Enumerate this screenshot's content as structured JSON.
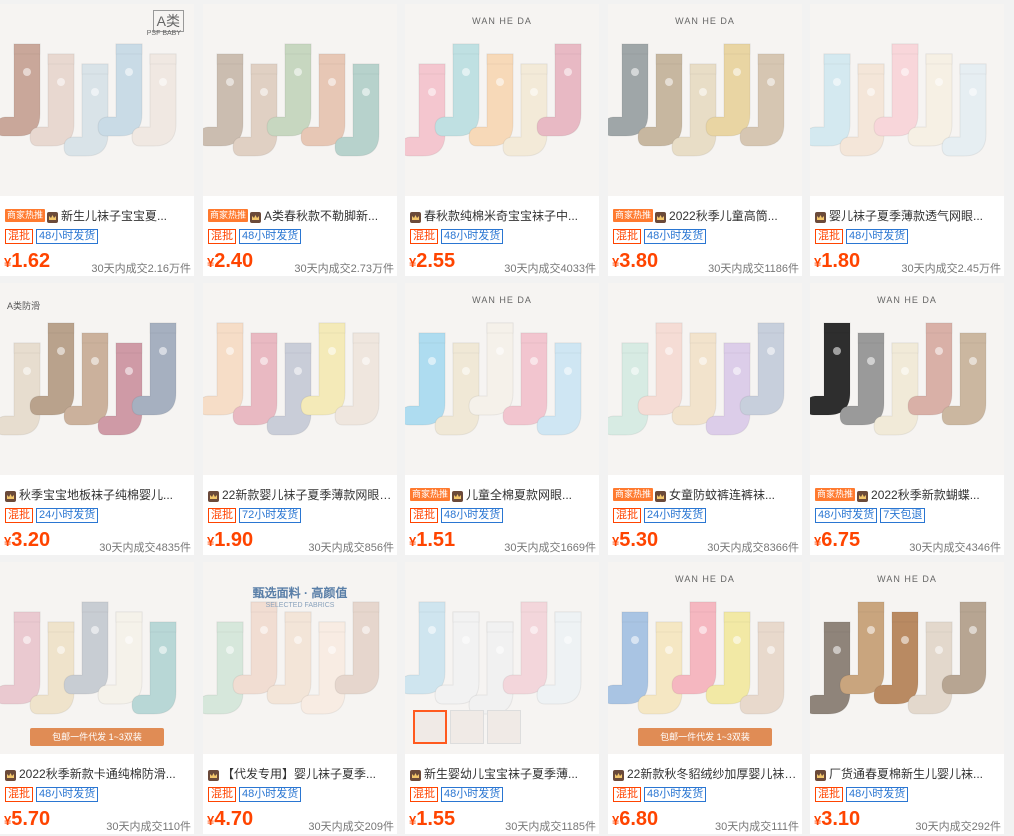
{
  "colors": {
    "price": "#ff4400",
    "tag_red": "#ff4400",
    "tag_blue": "#2a76d2",
    "hot_badge": "#ff7a2f",
    "page_bg": "#f2f2f2"
  },
  "products": [
    {
      "hot": "商家热推",
      "title": "新生儿袜子宝宝夏...",
      "tags": [
        "混批",
        "48小时发货"
      ],
      "price": "1.62",
      "sales": "30天内成交2.16万件",
      "overlay_text": "A类",
      "overlay_sub": "PSF BABY"
    },
    {
      "hot": "商家热推",
      "title": "A类春秋款不勒脚新...",
      "tags": [
        "混批",
        "48小时发货"
      ],
      "price": "2.40",
      "sales": "30天内成交2.73万件"
    },
    {
      "hot": "",
      "title": "春秋款纯棉米奇宝宝袜子中...",
      "tags": [
        "混批",
        "48小时发货"
      ],
      "price": "2.55",
      "sales": "30天内成交4033件",
      "overlay_text": "WAN HE DA"
    },
    {
      "hot": "商家热推",
      "title": "2022秋季儿童高筒...",
      "tags": [
        "混批",
        "48小时发货"
      ],
      "price": "3.80",
      "sales": "30天内成交1186件",
      "overlay_text": "WAN HE DA"
    },
    {
      "hot": "",
      "title": "婴儿袜子夏季薄款透气网眼...",
      "tags": [
        "混批",
        "48小时发货"
      ],
      "price": "1.80",
      "sales": "30天内成交2.45万件"
    },
    {
      "hot": "",
      "title": "秋季宝宝地板袜子纯棉婴儿...",
      "tags": [
        "混批",
        "24小时发货"
      ],
      "price": "3.20",
      "sales": "30天内成交4835件",
      "overlay_text": "A类防滑"
    },
    {
      "hot": "",
      "title": "22新款婴儿袜子夏季薄款网眼新...",
      "tags": [
        "混批",
        "72小时发货"
      ],
      "price": "1.90",
      "sales": "30天内成交856件"
    },
    {
      "hot": "商家热推",
      "title": "儿童全棉夏款网眼...",
      "tags": [
        "混批",
        "48小时发货"
      ],
      "price": "1.51",
      "sales": "30天内成交1669件",
      "overlay_text": "WAN HE DA"
    },
    {
      "hot": "商家热推",
      "title": "女童防蚊裤连裤袜...",
      "tags": [
        "混批",
        "24小时发货"
      ],
      "price": "5.30",
      "sales": "30天内成交8366件"
    },
    {
      "hot": "商家热推",
      "title": "2022秋季新款蝴蝶...",
      "tags": [
        "48小时发货",
        "7天包退"
      ],
      "price": "6.75",
      "sales": "30天内成交4346件",
      "overlay_text": "WAN HE DA"
    },
    {
      "hot": "",
      "title": "2022秋季新款卡通纯棉防滑...",
      "tags": [
        "混批",
        "48小时发货"
      ],
      "price": "5.70",
      "sales": "30天内成交110件",
      "overlay_text": "包邮一件代发 1~3双装"
    },
    {
      "hot": "",
      "title": "【代发专用】婴儿袜子夏季...",
      "tags": [
        "混批",
        "48小时发货"
      ],
      "price": "4.70",
      "sales": "30天内成交209件",
      "overlay_text": "甄选面料 · 高颜值",
      "overlay_sub": "SELECTED FABRICS"
    },
    {
      "hot": "",
      "title": "新生婴幼儿宝宝袜子夏季薄...",
      "tags": [
        "混批",
        "48小时发货"
      ],
      "price": "1.55",
      "sales": "30天内成交1185件"
    },
    {
      "hot": "",
      "title": "22新款秋冬貂绒纱加厚婴儿袜子...",
      "tags": [
        "混批",
        "48小时发货"
      ],
      "price": "6.80",
      "sales": "30天内成交111件",
      "overlay_text": "WAN HE DA",
      "overlay_sub": "包邮一件代发 1~3双装"
    },
    {
      "hot": "",
      "title": "厂货通春夏棉新生儿婴儿袜...",
      "tags": [
        "混批",
        "48小时发货"
      ],
      "price": "3.10",
      "sales": "30天内成交292件",
      "overlay_text": "WAN HE DA"
    }
  ],
  "currency": "¥",
  "sock_colors": [
    [
      "#c9a79a",
      "#e8d8d0",
      "#d9e3e8",
      "#c9dbe6",
      "#f0e8e2"
    ],
    [
      "#cbbdb0",
      "#e0d0c3",
      "#c7d7c0",
      "#e7c7b5",
      "#b7d2cc"
    ],
    [
      "#f4c6cf",
      "#bfe0e2",
      "#f7d9b8",
      "#f3ead8",
      "#e8b9c4"
    ],
    [
      "#9fa6a8",
      "#c7b7a0",
      "#e8ddc6",
      "#e9d5a3",
      "#d6c6b2"
    ],
    [
      "#d4e9f0",
      "#f4e6d9",
      "#f8d6da",
      "#f6f0e4",
      "#e6eef2"
    ],
    [
      "#e7ddcf",
      "#b9a28c",
      "#cbb19c",
      "#cf9aa6",
      "#a6b0c0"
    ],
    [
      "#f6ddc7",
      "#e9b9c2",
      "#c9cdd8",
      "#f4eab8",
      "#efe6de"
    ],
    [
      "#aedcf0",
      "#f0e8d6",
      "#f5f1ea",
      "#f2c5cf",
      "#cfe6f3"
    ],
    [
      "#d7ebe3",
      "#f5dcd5",
      "#f2e3cc",
      "#dccde9",
      "#c7cfdc"
    ],
    [
      "#2e2e2e",
      "#9a9a9a",
      "#f1ead8",
      "#d9b0a7",
      "#cbb7a0"
    ],
    [
      "#eac9d0",
      "#efe3cb",
      "#c8cdd3",
      "#f5f2ea",
      "#b8d7d6"
    ],
    [
      "#d6e7db",
      "#f1ddd2",
      "#f3e5d8",
      "#f8ece3",
      "#e6d6cd"
    ],
    [
      "#cfe5ef",
      "#f2f2f2",
      "#f1f1f1",
      "#f3d6db",
      "#eef2f4"
    ],
    [
      "#a9c4e3",
      "#f5e7c3",
      "#f5b7c0",
      "#f2e9a5",
      "#e8d9cc"
    ],
    [
      "#8f847a",
      "#c9a57e",
      "#b98a62",
      "#e3d8cc",
      "#b7a592"
    ]
  ]
}
